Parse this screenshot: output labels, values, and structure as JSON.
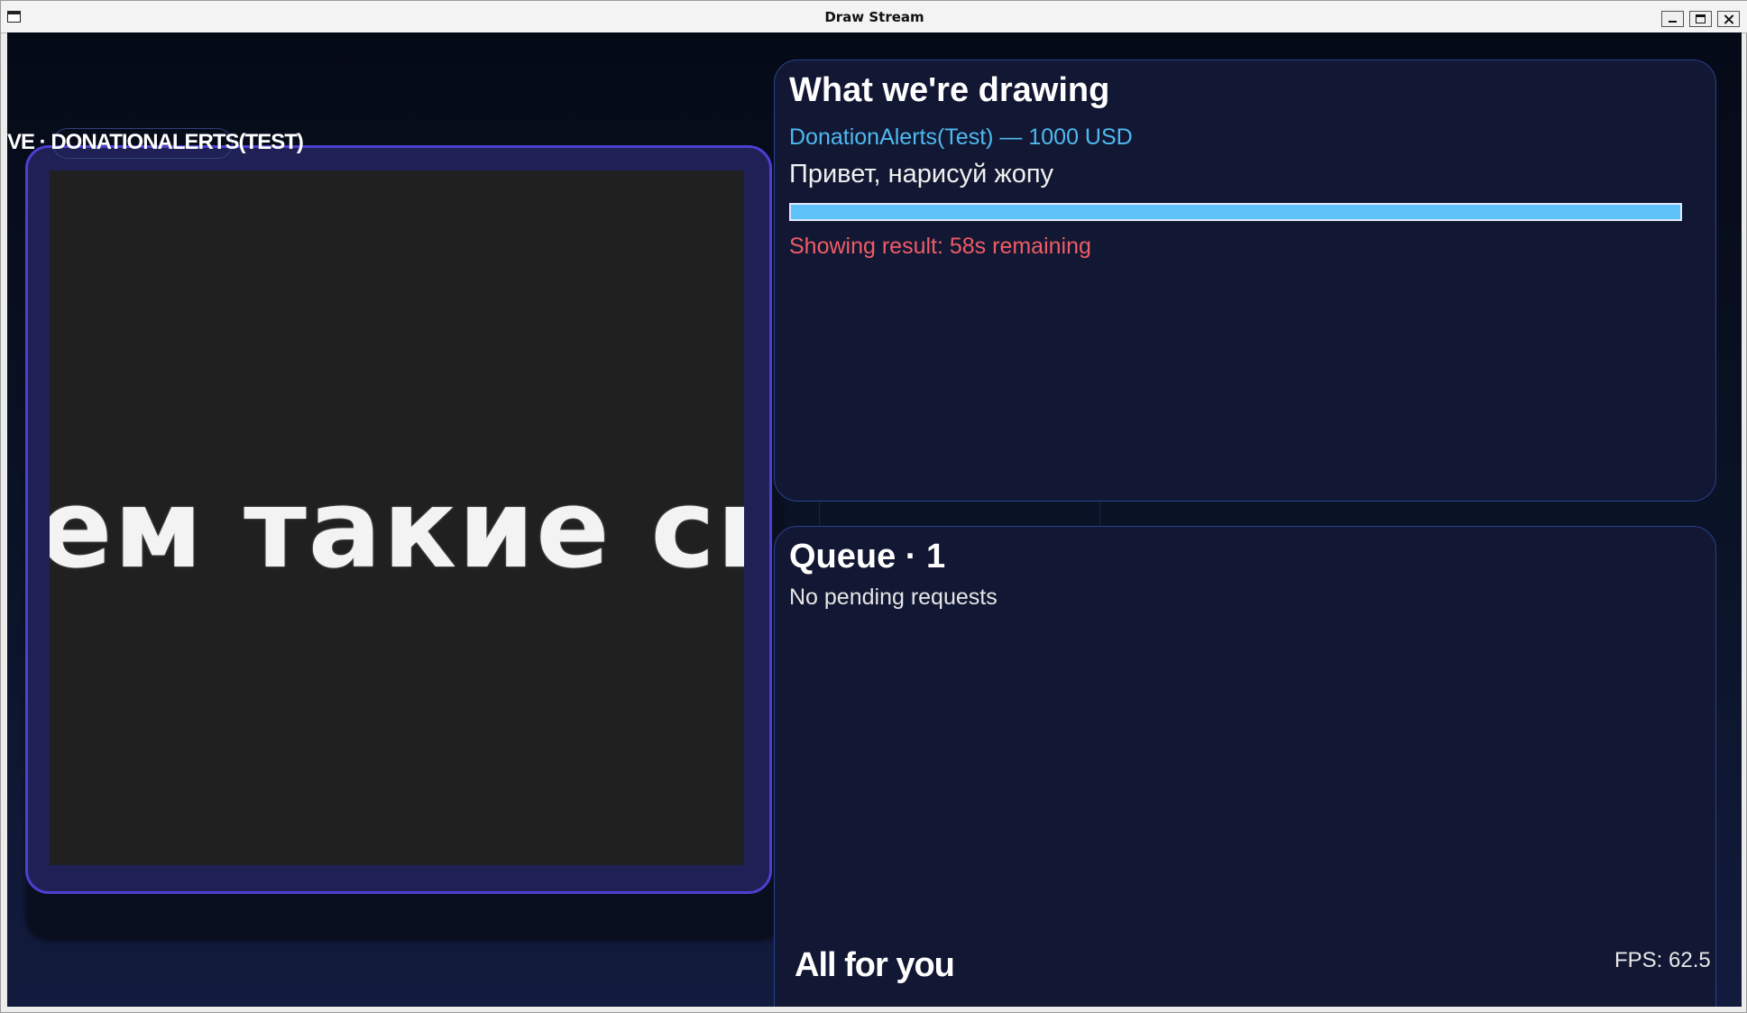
{
  "window": {
    "title": "Draw Stream"
  },
  "stage": {
    "tag_label": "VE · DONATIONALERTS(TEST)",
    "canvas_text": "ем такие сце"
  },
  "now_drawing": {
    "title": "What we're drawing",
    "donor": "DonationAlerts(Test) — 1000 USD",
    "message": "Привет, нарисуй жопу",
    "progress": 1.0,
    "status": "Showing result: 58s remaining"
  },
  "queue": {
    "title": "Queue · 1",
    "empty_text": "No pending requests"
  },
  "footer": {
    "title": "All for you",
    "fps": "FPS: 62.5"
  },
  "colors": {
    "accent": "#5ec1f8",
    "donor_text": "#4fb9f0",
    "status_text": "#ef5c66",
    "stage_border": "#4b40d0",
    "panel_border": "#29418a"
  },
  "icons": {
    "window_menu": "window-menu-icon",
    "minimize": "minimize-icon",
    "maximize": "maximize-icon",
    "close": "close-icon"
  }
}
